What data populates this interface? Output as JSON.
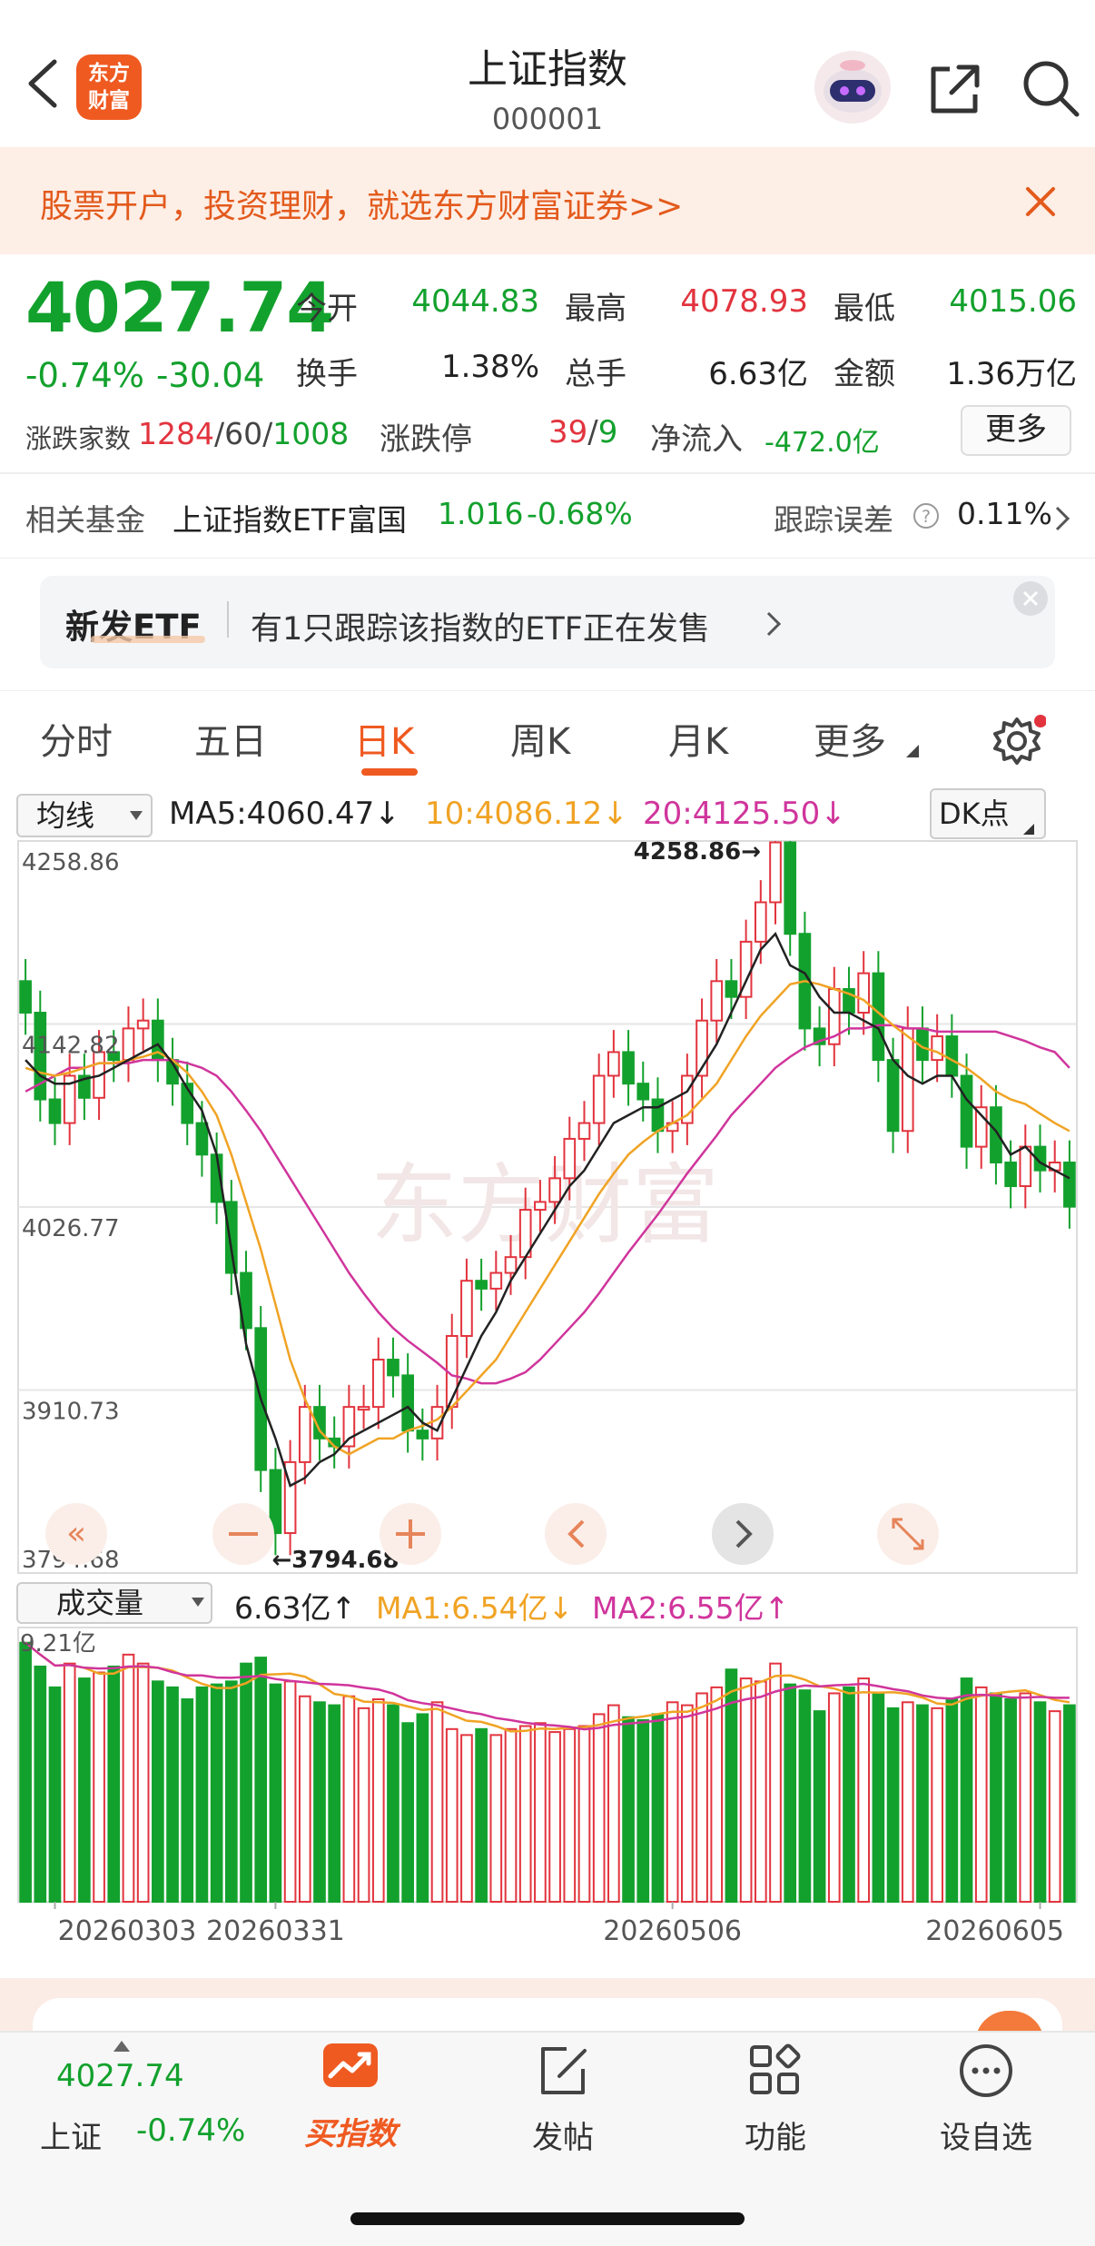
{
  "header": {
    "title": "上证指数",
    "code": "000001",
    "logo_line1": "东方",
    "logo_line2": "财富"
  },
  "banner": {
    "text": "股票开户，投资理财，就选东方财富证券>>"
  },
  "quote": {
    "price": "4027.74",
    "change_pct": "-0.74%",
    "change": "-30.04",
    "fields": [
      {
        "label": "今开",
        "value": "4044.83",
        "color": "#13a12d"
      },
      {
        "label": "最高",
        "value": "4078.93",
        "color": "#e2343e"
      },
      {
        "label": "最低",
        "value": "4015.06",
        "color": "#13a12d"
      },
      {
        "label": "换手",
        "value": "1.38%",
        "color": "#222222"
      },
      {
        "label": "总手",
        "value": "6.63亿",
        "color": "#222222"
      },
      {
        "label": "金额",
        "value": "1.36万亿",
        "color": "#222222"
      }
    ],
    "advance_label": "涨跌家数",
    "advance_up": "1284",
    "advance_flat": "60",
    "advance_down": "1008",
    "limit_label": "涨跌停",
    "limit_up": "39",
    "limit_down": "9",
    "inflow_label": "净流入",
    "inflow_value": "-472.0亿",
    "more_label": "更多"
  },
  "fund": {
    "label": "相关基金",
    "name": "上证指数ETF富国",
    "price": "1.016",
    "change": "-0.68%",
    "tracking_label": "跟踪误差",
    "tracking_value": "0.11%"
  },
  "etf": {
    "tag": "新发ETF",
    "text": "有1只跟踪该指数的ETF正在发售"
  },
  "tabs": [
    "分时",
    "五日",
    "日K",
    "周K",
    "月K",
    "更多"
  ],
  "active_tab": "日K",
  "chart_legend": {
    "select": "均线",
    "ma5": "MA5:4060.47↓",
    "ma10": "10:4086.12↓",
    "ma20": "20:4125.50↓",
    "dk": "DK点"
  },
  "volume_legend": {
    "select": "成交量",
    "vol": "6.63亿↑",
    "ma1": "MA1:6.54亿↓",
    "ma2": "MA2:6.55亿↑"
  },
  "watermark": "东方财富",
  "chart_data": {
    "type": "candlestick",
    "price_ticks": [
      "4258.86",
      "4142.82",
      "4026.77",
      "3910.73",
      "3794.68"
    ],
    "ylim": [
      3794.68,
      4258.86
    ],
    "high_label": "4258.86",
    "low_label": "3794.68",
    "volume_max_label": "9.21亿",
    "volume_ylim": [
      0,
      9.21
    ],
    "date_labels": [
      "20260303",
      "20260331",
      "20260506",
      "20260605"
    ],
    "close": [
      4150,
      4095,
      4080,
      4110,
      4096,
      4125,
      4120,
      4140,
      4145,
      4120,
      4105,
      4080,
      4060,
      4030,
      3985,
      3950,
      3860,
      3820,
      3865,
      3900,
      3880,
      3875,
      3900,
      3900,
      3930,
      3920,
      3885,
      3880,
      3900,
      3945,
      3980,
      3975,
      3985,
      3995,
      4025,
      4030,
      4045,
      4070,
      4080,
      4110,
      4125,
      4105,
      4095,
      4075,
      4080,
      4110,
      4145,
      4170,
      4160,
      4195,
      4220,
      4258,
      4200,
      4140,
      4130,
      4165,
      4150,
      4175,
      4120,
      4075,
      4140,
      4120,
      4135,
      4110,
      4065,
      4090,
      4055,
      4040,
      4065,
      4050,
      4055,
      4027
    ],
    "ma5": [
      4120,
      4110,
      4105,
      4105,
      4108,
      4110,
      4115,
      4120,
      4125,
      4130,
      4118,
      4102,
      4088,
      4060,
      4000,
      3940,
      3905,
      3880,
      3850,
      3855,
      3865,
      3870,
      3880,
      3885,
      3890,
      3895,
      3900,
      3890,
      3885,
      3905,
      3925,
      3945,
      3960,
      3980,
      3995,
      4010,
      4025,
      4040,
      4050,
      4065,
      4080,
      4085,
      4090,
      4090,
      4095,
      4100,
      4115,
      4130,
      4150,
      4170,
      4190,
      4200,
      4180,
      4175,
      4160,
      4150,
      4150,
      4145,
      4140,
      4120,
      4110,
      4105,
      4110,
      4110,
      4095,
      4085,
      4075,
      4060,
      4065,
      4055,
      4050,
      4045
    ],
    "ma10": [
      4115,
      4112,
      4110,
      4112,
      4115,
      4118,
      4118,
      4120,
      4122,
      4125,
      4120,
      4112,
      4100,
      4085,
      4060,
      4030,
      4000,
      3965,
      3930,
      3905,
      3885,
      3875,
      3870,
      3875,
      3880,
      3880,
      3885,
      3888,
      3892,
      3900,
      3910,
      3920,
      3930,
      3945,
      3960,
      3975,
      3990,
      4005,
      4020,
      4035,
      4048,
      4060,
      4068,
      4075,
      4080,
      4085,
      4095,
      4105,
      4120,
      4135,
      4148,
      4158,
      4168,
      4170,
      4168,
      4165,
      4162,
      4158,
      4150,
      4142,
      4135,
      4128,
      4125,
      4120,
      4115,
      4108,
      4100,
      4095,
      4092,
      4086,
      4080,
      4075
    ],
    "ma20": [
      4100,
      4105,
      4110,
      4115,
      4115,
      4118,
      4118,
      4118,
      4120,
      4120,
      4120,
      4118,
      4115,
      4110,
      4100,
      4088,
      4075,
      4060,
      4045,
      4030,
      4015,
      4000,
      3985,
      3972,
      3960,
      3950,
      3942,
      3935,
      3928,
      3920,
      3918,
      3915,
      3915,
      3918,
      3922,
      3930,
      3940,
      3950,
      3960,
      3972,
      3985,
      3998,
      4010,
      4022,
      4035,
      4048,
      4060,
      4072,
      4085,
      4095,
      4105,
      4115,
      4122,
      4128,
      4132,
      4135,
      4140,
      4140,
      4142,
      4142,
      4140,
      4140,
      4138,
      4138,
      4138,
      4138,
      4138,
      4135,
      4132,
      4128,
      4125,
      4115
    ],
    "volume": [
      8.7,
      7.9,
      7.2,
      8.0,
      7.5,
      7.7,
      7.9,
      8.3,
      8.0,
      7.4,
      7.2,
      6.8,
      7.2,
      7.3,
      7.4,
      8.0,
      8.2,
      7.3,
      7.4,
      6.9,
      6.7,
      6.6,
      6.9,
      6.5,
      6.8,
      6.6,
      6.0,
      6.3,
      6.7,
      5.8,
      5.6,
      5.8,
      5.6,
      5.8,
      5.9,
      6.0,
      5.7,
      5.8,
      5.9,
      6.3,
      6.6,
      6.2,
      6.1,
      6.3,
      6.7,
      6.6,
      7.0,
      7.2,
      7.8,
      7.5,
      7.4,
      8.0,
      7.3,
      7.1,
      6.4,
      7.0,
      7.2,
      7.5,
      7.0,
      6.5,
      6.7,
      6.6,
      6.5,
      6.8,
      7.5,
      7.2,
      7.0,
      6.8,
      7.0,
      6.7,
      6.4,
      6.6
    ]
  },
  "bottom_nav": {
    "index_price": "4027.74",
    "index_name": "上证",
    "index_change": "-0.74%",
    "buy_label": "买指数",
    "post_label": "发帖",
    "func_label": "功能",
    "watch_label": "设自选"
  }
}
